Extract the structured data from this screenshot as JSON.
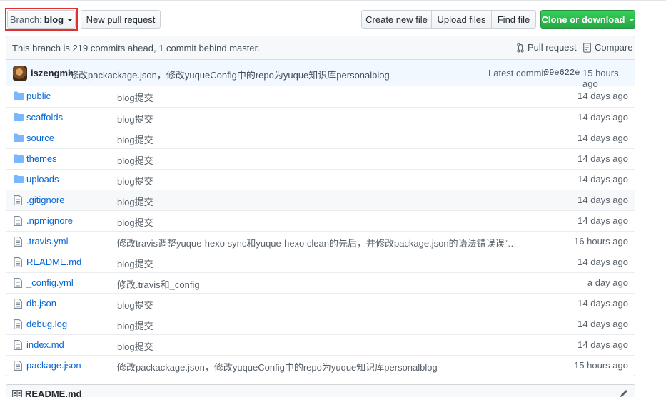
{
  "toolbar": {
    "branch_prefix": "Branch:",
    "branch_name": "blog",
    "new_pull_request": "New pull request",
    "create_new_file": "Create new file",
    "upload_files": "Upload files",
    "find_file": "Find file",
    "clone_or_download": "Clone or download"
  },
  "branch_status": {
    "text": "This branch is 219 commits ahead, 1 commit behind master.",
    "pull_request": "Pull request",
    "compare": "Compare"
  },
  "latest_commit": {
    "author": "iszengmh",
    "message": "修改packackage.json，修改yuqueConfig中的repo为yuque知识库personalblog",
    "label": "Latest commit",
    "sha": "09e622e",
    "time": "15 hours ago"
  },
  "files": [
    {
      "type": "folder",
      "name": "public",
      "message": "blog提交",
      "age": "14 days ago"
    },
    {
      "type": "folder",
      "name": "scaffolds",
      "message": "blog提交",
      "age": "14 days ago"
    },
    {
      "type": "folder",
      "name": "source",
      "message": "blog提交",
      "age": "14 days ago"
    },
    {
      "type": "folder",
      "name": "themes",
      "message": "blog提交",
      "age": "14 days ago"
    },
    {
      "type": "folder",
      "name": "uploads",
      "message": "blog提交",
      "age": "14 days ago"
    },
    {
      "type": "file",
      "name": ".gitignore",
      "message": "blog提交",
      "age": "14 days ago"
    },
    {
      "type": "file",
      "name": ".npmignore",
      "message": "blog提交",
      "age": "14 days ago"
    },
    {
      "type": "file",
      "name": ".travis.yml",
      "message": "修改travis调整yuque-hexo sync和yuque-hexo clean的先后，并修改package.json的语法错误误“没…",
      "age": "16 hours ago"
    },
    {
      "type": "file",
      "name": "README.md",
      "message": "blog提交",
      "age": "14 days ago"
    },
    {
      "type": "file",
      "name": "_config.yml",
      "message": "修改.travis和_config",
      "age": "a day ago"
    },
    {
      "type": "file",
      "name": "db.json",
      "message": "blog提交",
      "age": "14 days ago"
    },
    {
      "type": "file",
      "name": "debug.log",
      "message": "blog提交",
      "age": "14 days ago"
    },
    {
      "type": "file",
      "name": "index.md",
      "message": "blog提交",
      "age": "14 days ago"
    },
    {
      "type": "file",
      "name": "package.json",
      "message": "修改packackage.json，修改yuqueConfig中的repo为yuque知识库personalblog",
      "age": "15 hours ago"
    }
  ],
  "readme": {
    "title": "README.md"
  },
  "colors": {
    "link": "#0366d6",
    "clone_button": "#28a745",
    "branch_highlight": "#e0302f",
    "folder_icon": "#79b8ff"
  }
}
